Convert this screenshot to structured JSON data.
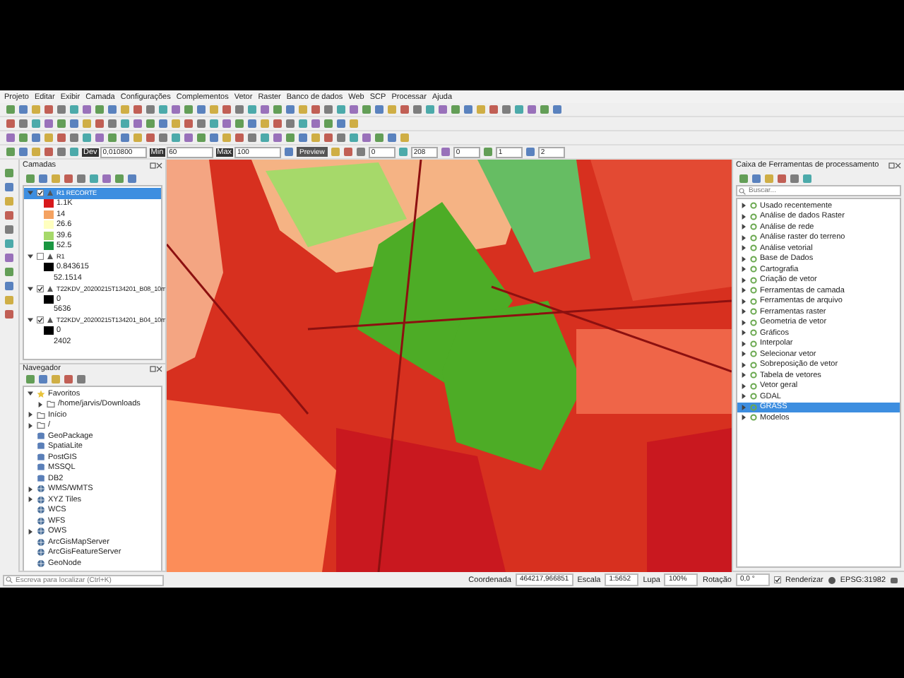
{
  "menu": [
    "Projeto",
    "Editar",
    "Exibir",
    "Camada",
    "Configurações",
    "Complementos",
    "Vetor",
    "Raster",
    "Banco de dados",
    "Web",
    "SCP",
    "Processar",
    "Ajuda"
  ],
  "raster_toolbar": {
    "fields": [
      {
        "label": "Dev",
        "value": "0,010800"
      },
      {
        "label": "Min",
        "value": "60"
      },
      {
        "label": "Max",
        "value": "100"
      }
    ],
    "preview": "Preview",
    "spins": [
      "0",
      "208",
      "0",
      "1",
      "2"
    ]
  },
  "layers_panel": {
    "title": "Camadas",
    "layers": [
      {
        "name": "R1 RECORTE",
        "checked": true,
        "selected": true,
        "expanded": true,
        "legend": [
          {
            "color": "#d7191c",
            "label": "1.1K"
          },
          {
            "color": "#f4a261",
            "label": "14"
          },
          {
            "color": "#ffffbf",
            "label": "26.6"
          },
          {
            "color": "#a6d96a",
            "label": "39.6"
          },
          {
            "color": "#1a9641",
            "label": "52.5"
          }
        ]
      },
      {
        "name": "R1",
        "checked": false,
        "selected": false,
        "expanded": true,
        "legend": [
          {
            "color": "#000000",
            "label": "0.843615"
          },
          {
            "label": "52.1514"
          }
        ]
      },
      {
        "name": "T22KDV_20200215T134201_B08_10m",
        "checked": true,
        "selected": false,
        "expanded": true,
        "legend": [
          {
            "color": "#000000",
            "label": "0"
          },
          {
            "label": "5636"
          }
        ]
      },
      {
        "name": "T22KDV_20200215T134201_B04_10m",
        "checked": true,
        "selected": false,
        "expanded": true,
        "legend": [
          {
            "color": "#000000",
            "label": "0"
          },
          {
            "label": "2402"
          }
        ]
      }
    ]
  },
  "navigator": {
    "title": "Navegador",
    "items": [
      {
        "label": "Favoritos",
        "kind": "favorites",
        "expanded": true,
        "children": [
          {
            "label": "/home/jarvis/Downloads",
            "kind": "folder",
            "expanded": false
          }
        ]
      },
      {
        "label": "Início",
        "kind": "folder",
        "expanded": false
      },
      {
        "label": "/",
        "kind": "folder",
        "expanded": false
      },
      {
        "label": "GeoPackage",
        "kind": "database"
      },
      {
        "label": "SpatiaLite",
        "kind": "database"
      },
      {
        "label": "PostGIS",
        "kind": "database"
      },
      {
        "label": "MSSQL",
        "kind": "database"
      },
      {
        "label": "DB2",
        "kind": "database"
      },
      {
        "label": "WMS/WMTS",
        "kind": "web",
        "expanded": false
      },
      {
        "label": "XYZ Tiles",
        "kind": "web",
        "expanded": false
      },
      {
        "label": "WCS",
        "kind": "web"
      },
      {
        "label": "WFS",
        "kind": "web"
      },
      {
        "label": "OWS",
        "kind": "web",
        "expanded": false
      },
      {
        "label": "ArcGisMapServer",
        "kind": "web"
      },
      {
        "label": "ArcGisFeatureServer",
        "kind": "web"
      },
      {
        "label": "GeoNode",
        "kind": "web"
      }
    ]
  },
  "locator": {
    "placeholder": "Escreva para localizar (Ctrl+K)"
  },
  "toolbox": {
    "title": "Caixa de Ferramentas de processamento",
    "search_placeholder": "Buscar...",
    "items": [
      {
        "label": "Usado recentemente",
        "selected": false
      },
      {
        "label": "Análise de dados Raster",
        "selected": false
      },
      {
        "label": "Análise de rede",
        "selected": false
      },
      {
        "label": "Análise raster do terreno",
        "selected": false
      },
      {
        "label": "Análise vetorial",
        "selected": false
      },
      {
        "label": "Base de Dados",
        "selected": false
      },
      {
        "label": "Cartografia",
        "selected": false
      },
      {
        "label": "Criação de vetor",
        "selected": false
      },
      {
        "label": "Ferramentas de camada",
        "selected": false
      },
      {
        "label": "Ferramentas de arquivo",
        "selected": false
      },
      {
        "label": "Ferramentas raster",
        "selected": false
      },
      {
        "label": "Geometria de vetor",
        "selected": false
      },
      {
        "label": "Gráficos",
        "selected": false
      },
      {
        "label": "Interpolar",
        "selected": false
      },
      {
        "label": "Selecionar vetor",
        "selected": false
      },
      {
        "label": "Sobreposição de vetor",
        "selected": false
      },
      {
        "label": "Tabela de vetores",
        "selected": false
      },
      {
        "label": "Vetor geral",
        "selected": false
      },
      {
        "label": "GDAL",
        "selected": false
      },
      {
        "label": "GRASS",
        "selected": true
      },
      {
        "label": "Modelos",
        "selected": false
      }
    ]
  },
  "status_bar": {
    "coordinate_label": "Coordenada",
    "coordinate": "464217,966851",
    "scale_label": "Escala",
    "scale": "1:5652",
    "magnifier_label": "Lupa",
    "magnifier": "100%",
    "rotation_label": "Rotação",
    "rotation": "0,0 °",
    "render_label": "Renderizar",
    "render": true,
    "crs": "EPSG:31982"
  }
}
